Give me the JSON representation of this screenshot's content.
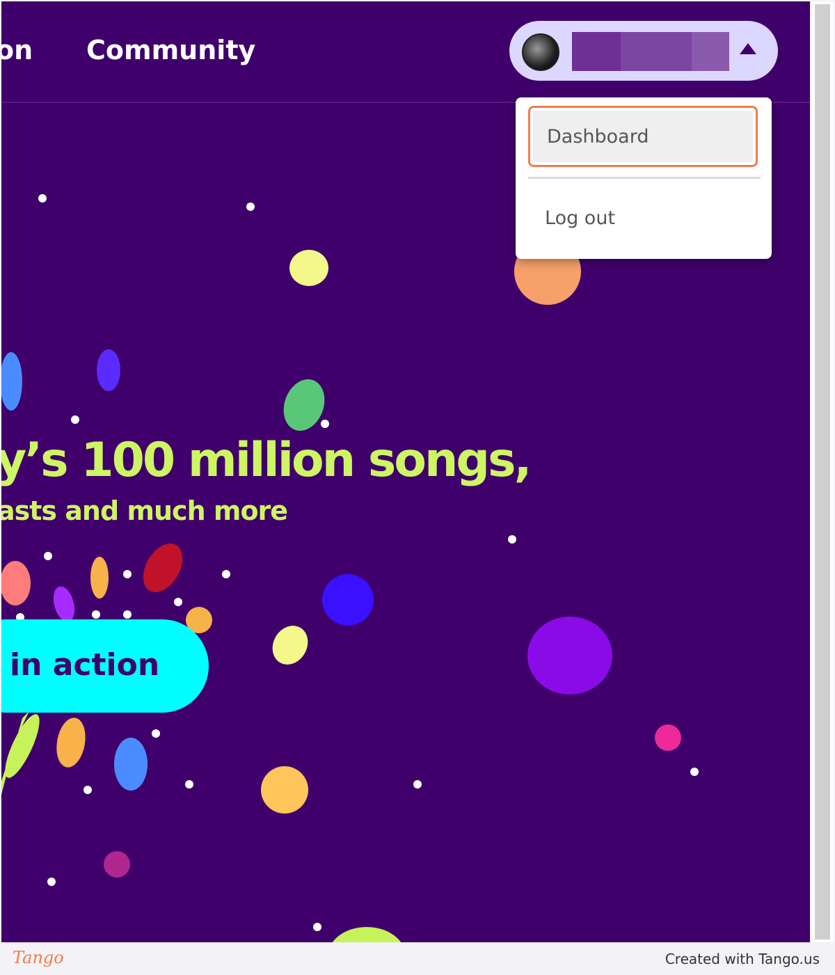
{
  "nav": {
    "partial_item": "on",
    "community": "Community"
  },
  "account": {
    "username_redacted": true,
    "menu": {
      "dashboard": "Dashboard",
      "logout": "Log out"
    }
  },
  "hero": {
    "title": "y’s 100 million songs,",
    "subtitle": "asts and much more",
    "cta": "in action"
  },
  "footer": {
    "logo": "Tango",
    "credit": "Created with Tango.us"
  },
  "colors": {
    "background": "#40006b",
    "accent_green": "#cdf564",
    "cta": "#00ffff",
    "highlight": "#f07c4c"
  }
}
